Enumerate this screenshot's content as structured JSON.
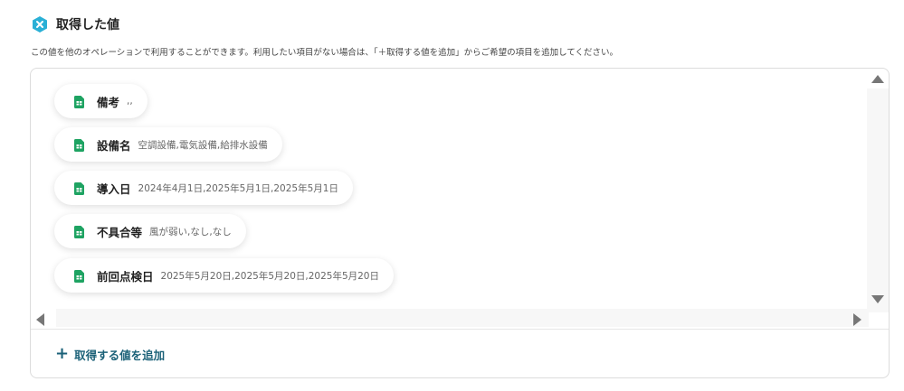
{
  "header": {
    "title": "取得した値",
    "icon": "x-badge-icon",
    "icon_color": "#2ab0d6"
  },
  "description": "この値を他のオペレーションで利用することができます。利用したい項目がない場合は、「＋取得する値を追加」からご希望の項目を追加してください。",
  "items": [
    {
      "label": "備考",
      "value": ",,",
      "icon": "google-sheets-icon"
    },
    {
      "label": "設備名",
      "value": "空調設備,電気設備,給排水設備",
      "icon": "google-sheets-icon"
    },
    {
      "label": "導入日",
      "value": "2024年4月1日,2025年5月1日,2025年5月1日",
      "icon": "google-sheets-icon"
    },
    {
      "label": "不具合等",
      "value": "風が弱い,なし,なし",
      "icon": "google-sheets-icon"
    },
    {
      "label": "前回点検日",
      "value": "2025年5月20日,2025年5月20日,2025年5月20日",
      "icon": "google-sheets-icon"
    }
  ],
  "add_button": {
    "plus": "+",
    "label": "取得する値を追加"
  },
  "colors": {
    "accent": "#1b6178",
    "sheets_green": "#1ea362"
  }
}
